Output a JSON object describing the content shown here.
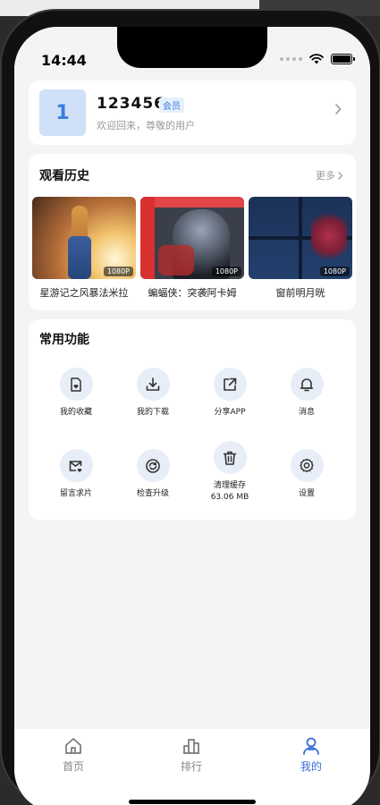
{
  "status_bar": {
    "time": "14:44"
  },
  "profile": {
    "avatar_text": "1",
    "username": "123456",
    "badge": "会员",
    "welcome": "欢迎回来，尊敬的用户"
  },
  "history": {
    "title": "观看历史",
    "more": "更多",
    "items": [
      {
        "title": "星游记之风暴法米拉",
        "resolution": "1080P"
      },
      {
        "title": "蝙蝠侠：突袭阿卡姆",
        "resolution": "1080P"
      },
      {
        "title": "窗前明月晄",
        "resolution": "1080P"
      }
    ]
  },
  "functions": {
    "title": "常用功能",
    "items": [
      {
        "label": "我的收藏",
        "icon": "favorites-icon"
      },
      {
        "label": "我的下载",
        "icon": "download-icon"
      },
      {
        "label": "分享APP",
        "icon": "share-icon"
      },
      {
        "label": "消息",
        "icon": "bell-icon"
      },
      {
        "label": "留言求片",
        "icon": "mail-icon"
      },
      {
        "label": "检查升级",
        "icon": "refresh-icon"
      },
      {
        "label": "清理缓存",
        "sub": "63.06 MB",
        "icon": "trash-icon"
      },
      {
        "label": "设置",
        "icon": "gear-icon"
      }
    ]
  },
  "tabs": [
    {
      "label": "首页",
      "icon": "home-icon"
    },
    {
      "label": "排行",
      "icon": "ranking-icon"
    },
    {
      "label": "我的",
      "icon": "user-icon",
      "active": true
    }
  ],
  "colors": {
    "accent": "#3a6fd8",
    "icon_bg": "#e8eef8",
    "avatar_bg": "#cfe0f7"
  }
}
